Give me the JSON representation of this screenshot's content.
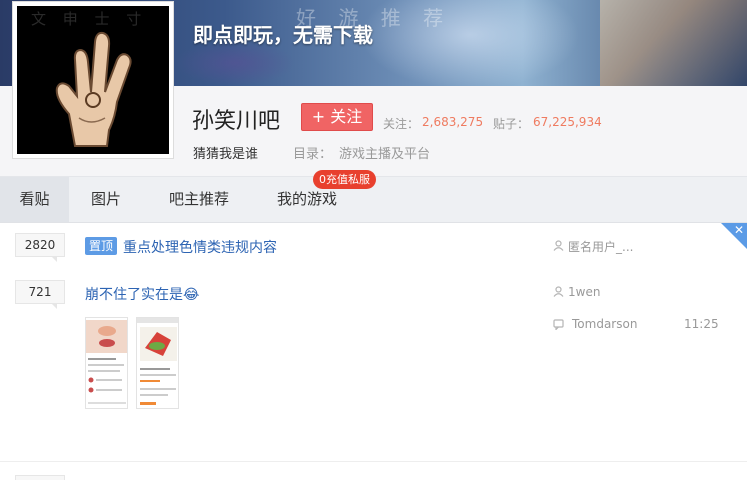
{
  "banner": {
    "headline": "即点即玩，无需下载",
    "faint_text": "好 游 推 荐"
  },
  "forum": {
    "name": "孙笑川吧",
    "follow_label": "+ 关注",
    "followers_label": "关注：",
    "followers_value": "2,683,275",
    "posts_label": "贴子：",
    "posts_value": "67,225,934",
    "slogan": "猜猜我是谁",
    "directory_label": "目录：",
    "directory_value": "游戏主播及平台",
    "avatar_text": "文 申 士 寸"
  },
  "tabs": [
    {
      "label": "看贴",
      "active": true
    },
    {
      "label": "图片",
      "active": false
    },
    {
      "label": "吧主推荐",
      "active": false
    },
    {
      "label": "我的游戏",
      "active": false
    }
  ],
  "tab_badge": "0充值私服",
  "threads": [
    {
      "replies": "2820",
      "pinned": true,
      "pin_label": "置顶",
      "title": "重点处理色情类违规内容",
      "author": "匿名用户_..."
    },
    {
      "replies": "721",
      "pinned": false,
      "title": "崩不住了实在是",
      "title_emoji": "😂",
      "author": "1wen",
      "last_reply_user": "Tomdarson",
      "last_reply_time": "11:25"
    }
  ],
  "colors": {
    "follow": "#f06464",
    "stat_value": "#ef7b60",
    "link": "#2d64b3",
    "pin": "#5d9be5",
    "badge": "#e8402e"
  },
  "icons": {
    "user": "user-icon",
    "reply": "reply-icon",
    "close": "close-icon"
  }
}
